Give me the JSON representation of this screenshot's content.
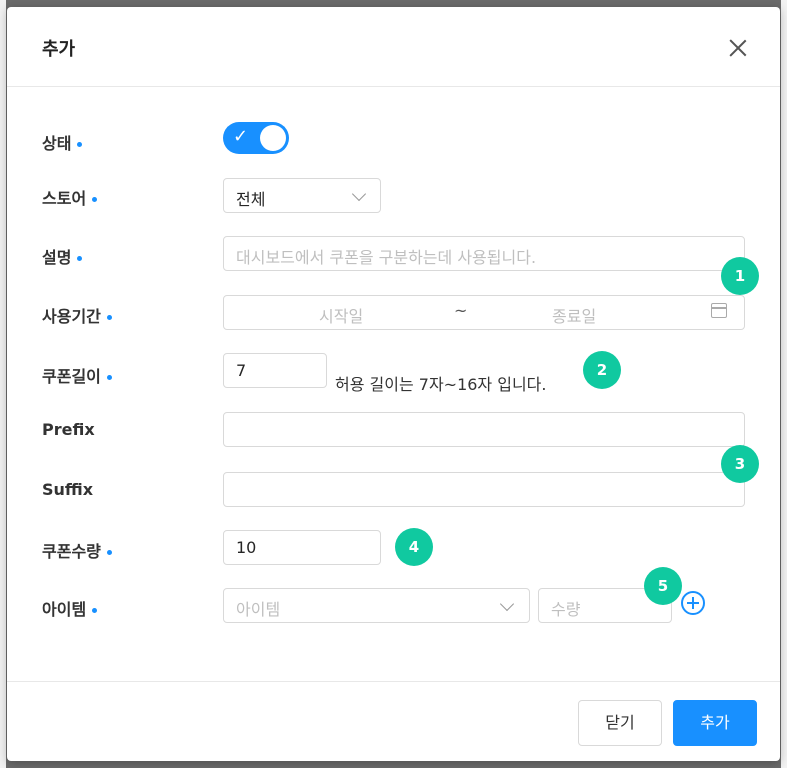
{
  "modal": {
    "title": "추가",
    "close_icon": "close-icon"
  },
  "form": {
    "status": {
      "label": "상태",
      "enabled": true
    },
    "store": {
      "label": "스토어",
      "value": "전체"
    },
    "description": {
      "label": "설명",
      "placeholder": "대시보드에서 쿠폰을 구분하는데 사용됩니다."
    },
    "period": {
      "label": "사용기간",
      "start_placeholder": "시작일",
      "separator": "~",
      "end_placeholder": "종료일"
    },
    "coupon_length": {
      "label": "쿠폰길이",
      "value": "7",
      "hint": "허용 길이는 7자~16자 입니다."
    },
    "prefix": {
      "label": "Prefix",
      "value": ""
    },
    "suffix": {
      "label": "Suffix",
      "value": ""
    },
    "coupon_count": {
      "label": "쿠폰수량",
      "value": "10"
    },
    "item": {
      "label": "아이템",
      "item_placeholder": "아이템",
      "qty_placeholder": "수량"
    }
  },
  "badges": [
    "1",
    "2",
    "3",
    "4",
    "5"
  ],
  "footer": {
    "close_label": "닫기",
    "add_label": "추가"
  },
  "colors": {
    "primary": "#1890ff",
    "badge": "#10c9a0"
  }
}
